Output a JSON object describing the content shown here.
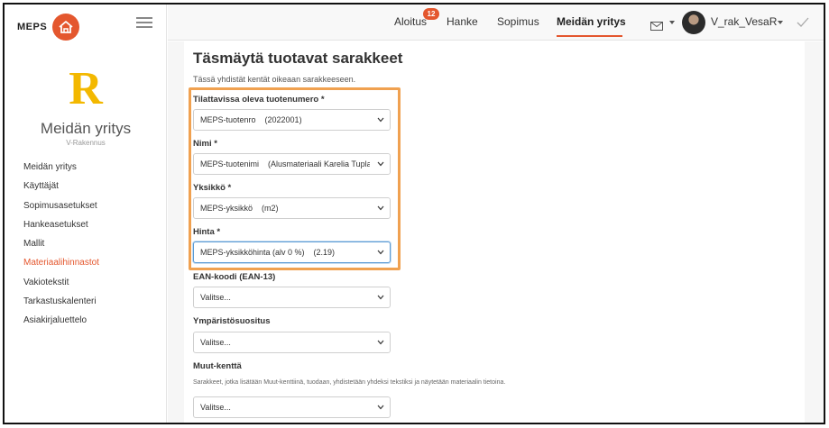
{
  "brand": {
    "name": "MEPS",
    "accent_color": "#e4572e",
    "logo_icon": "house-logo-icon"
  },
  "sidebar": {
    "company_initial": "R",
    "company_name": "Meidän yritys",
    "company_subtitle": "V-Rakennus",
    "items": [
      {
        "label": "Meidän yritys",
        "active": false
      },
      {
        "label": "Käyttäjät",
        "active": false
      },
      {
        "label": "Sopimusasetukset",
        "active": false
      },
      {
        "label": "Hankeasetukset",
        "active": false
      },
      {
        "label": "Mallit",
        "active": false
      },
      {
        "label": "Materiaalihinnastot",
        "active": true
      },
      {
        "label": "Vakiotekstit",
        "active": false
      },
      {
        "label": "Tarkastuskalenteri",
        "active": false
      },
      {
        "label": "Asiakirjaluettelo",
        "active": false
      }
    ]
  },
  "topbar": {
    "nav": [
      {
        "label": "Aloitus",
        "badge": "12",
        "active": false
      },
      {
        "label": "Hanke",
        "active": false
      },
      {
        "label": "Sopimus",
        "active": false
      },
      {
        "label": "Meidän yritys",
        "active": true
      }
    ],
    "user_name": "V_rak_VesaR",
    "icons": [
      "mail-icon",
      "avatar",
      "check-icon"
    ]
  },
  "main": {
    "title": "Täsmäytä tuotavat sarakkeet",
    "description": "Tässä yhdistät kentät oikeaan sarakkeeseen.",
    "fields": [
      {
        "label": "Tilattavissa oleva tuotenumero *",
        "value": "MEPS-tuotenro    (2022001)"
      },
      {
        "label": "Nimi *",
        "value": "MEPS-tuotenimi    (Alusmateriaali Karelia Tupla"
      },
      {
        "label": "Yksikkö *",
        "value": "MEPS-yksikkö    (m2)"
      },
      {
        "label": "Hinta *",
        "value": "MEPS-yksikköhinta (alv 0 %)    (2.19)"
      },
      {
        "label": "EAN-koodi (EAN-13)",
        "value": "Valitse..."
      },
      {
        "label": "Ympäristösuositus",
        "value": "Valitse..."
      },
      {
        "label": "Muut-kenttä",
        "hint": "Sarakkeet, jotka lisätään Muut-kenttiinä, tuodaan, yhdistetään yhdeksi tekstiksi ja näytetään materiaalin tietoina.",
        "value": "Valitse..."
      }
    ],
    "highlight_color": "#f0a150"
  }
}
